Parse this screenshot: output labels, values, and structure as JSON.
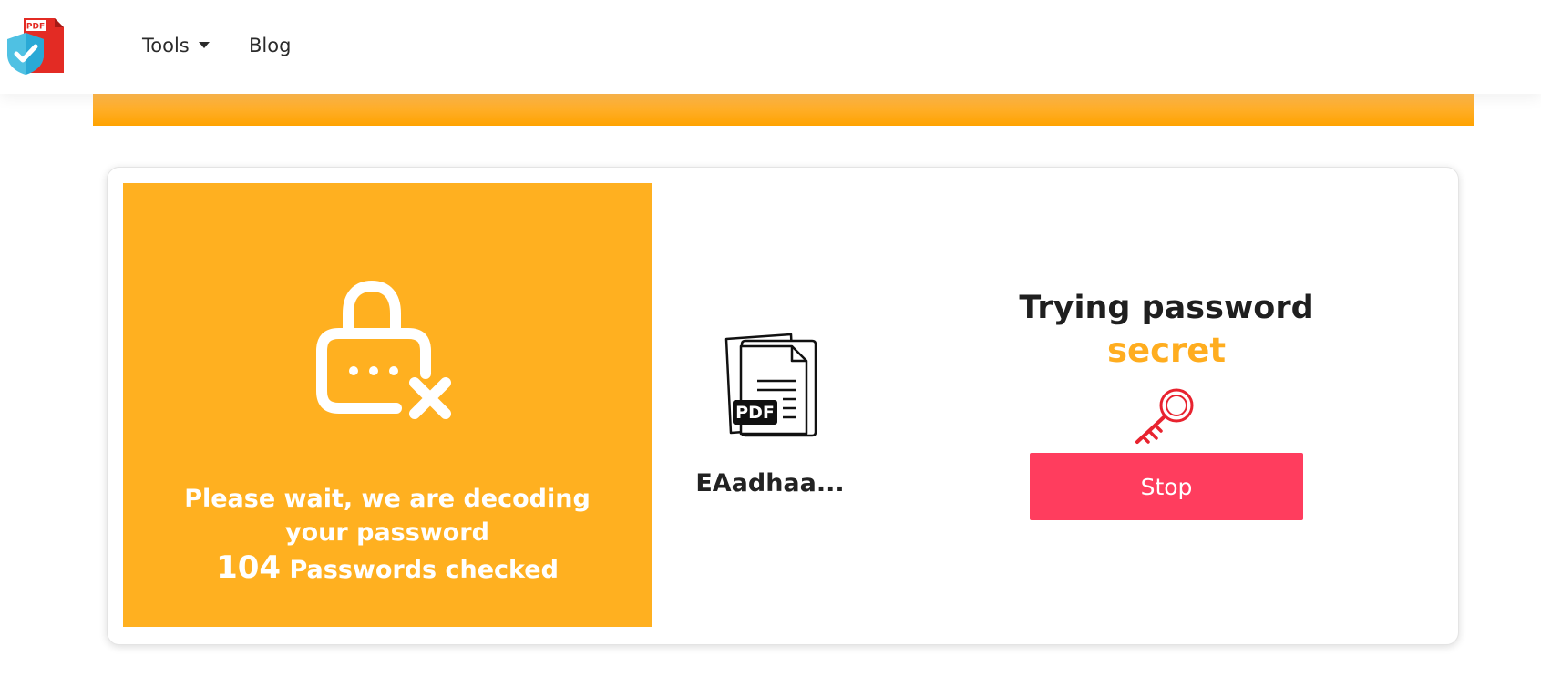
{
  "nav": {
    "logo_badge": "PDF",
    "tools_label": "Tools",
    "blog_label": "Blog"
  },
  "status": {
    "message": "Please wait, we are decoding your password",
    "count": "104",
    "count_suffix": "Passwords checked"
  },
  "file": {
    "icon_badge": "PDF",
    "name": "EAadhaa..."
  },
  "attempt": {
    "label": "Trying password",
    "current_password": "secret"
  },
  "actions": {
    "stop_label": "Stop"
  },
  "colors": {
    "accent_orange": "#ffb020",
    "bar_orange": "#ffa300",
    "stop_red": "#ff3d5e",
    "key_red": "#e8232f",
    "password_orange": "#ffad1f"
  },
  "icons": [
    "pdf-shield-logo-icon",
    "lock-x-icon",
    "pdf-file-icon",
    "key-icon",
    "chevron-down-icon"
  ]
}
